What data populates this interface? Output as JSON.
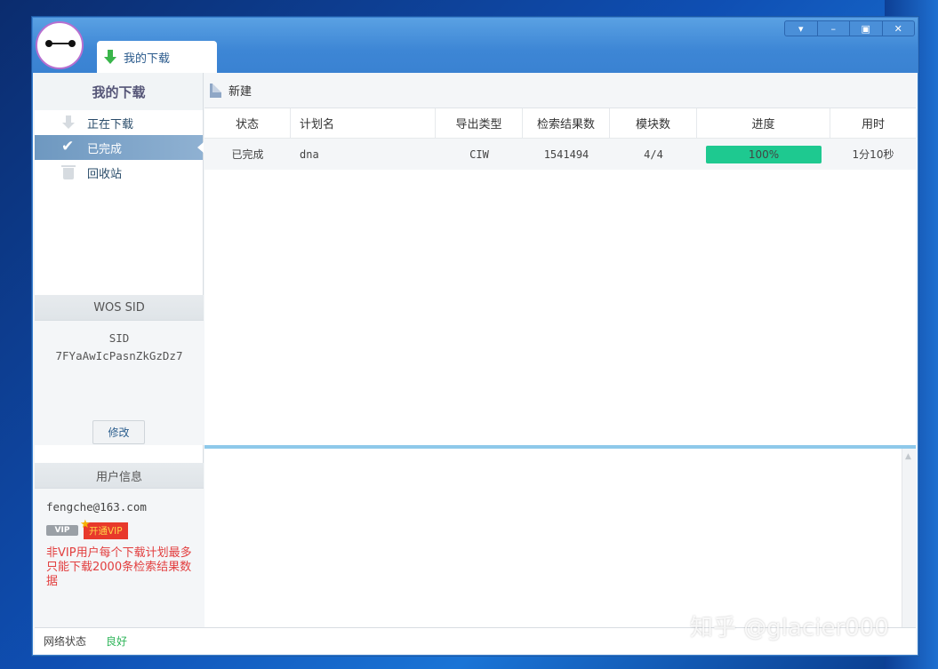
{
  "tab": {
    "label": "我的下载"
  },
  "sidebar": {
    "title": "我的下载",
    "items": [
      {
        "label": "正在下载",
        "icon": "download-arrow-icon",
        "active": false
      },
      {
        "label": "已完成",
        "icon": "check-icon",
        "active": true
      },
      {
        "label": "回收站",
        "icon": "trash-icon",
        "active": false
      }
    ]
  },
  "sid_panel": {
    "header": "WOS SID",
    "label": "SID",
    "value": "7FYaAwIcPasnZkGzDz7",
    "modify_label": "修改"
  },
  "user_panel": {
    "header": "用户信息",
    "email": "fengche@163.com",
    "vip_badge": "VIP",
    "open_vip_label": "开通VIP",
    "note": "非VIP用户每个下载计划最多只能下载2000条检索结果数据"
  },
  "toolbar": {
    "new_label": "新建"
  },
  "table": {
    "columns": [
      "状态",
      "计划名",
      "导出类型",
      "检索结果数",
      "模块数",
      "进度",
      "用时"
    ],
    "rows": [
      {
        "status": "已完成",
        "name": "dna",
        "type": "CIW",
        "results": "1541494",
        "modules": "4/4",
        "progress": 100,
        "progress_text": "100%",
        "time": "1分10秒"
      }
    ]
  },
  "statusbar": {
    "label": "网络状态",
    "value": "良好"
  },
  "watermark": "知乎 @glacier000",
  "colors": {
    "progress": "#1ec990",
    "accent": "#3d86d5",
    "status_good": "#2fb55a",
    "warning": "#e23e3e"
  }
}
